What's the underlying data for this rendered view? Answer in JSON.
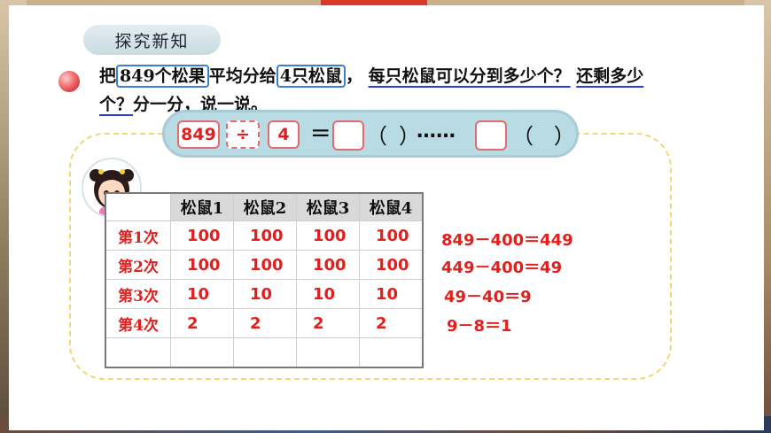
{
  "header": {
    "section_title": "探究新知"
  },
  "problem": {
    "part1": "把",
    "quantity": "849个松果",
    "part2": "平均分给",
    "squirrels": "4只松鼠",
    "part3": "，",
    "question1": "每只松鼠可以分到多少个？",
    "question2_a": "还剩多少",
    "question2_b": "个？",
    "part4": "分一分，说一说。"
  },
  "equation": {
    "dividend": "849",
    "operator": "÷",
    "divisor": "4",
    "equals": "=",
    "quotient": "",
    "unit_open": "（",
    "unit_close": "）",
    "dots": "……",
    "remainder": "",
    "unit2": "（   ）"
  },
  "table": {
    "headers": [
      "",
      "松鼠1",
      "松鼠2",
      "松鼠3",
      "松鼠4"
    ],
    "rows": [
      {
        "label": "第1次",
        "values": [
          "100",
          "100",
          "100",
          "100"
        ]
      },
      {
        "label": "第2次",
        "values": [
          "100",
          "100",
          "100",
          "100"
        ]
      },
      {
        "label": "第3次",
        "values": [
          "10",
          "10",
          "10",
          "10"
        ]
      },
      {
        "label": "第4次",
        "values": [
          "2",
          "2",
          "2",
          "2"
        ]
      },
      {
        "label": "",
        "values": [
          "",
          "",
          "",
          ""
        ]
      }
    ]
  },
  "calculations": [
    "849－400＝449",
    "449－400＝49",
    "49－40＝9",
    "9－8＝1"
  ],
  "colors": {
    "accent_red": "#e0201e",
    "box_blue": "#3a7fd0",
    "bar_blue": "#b8dbe4"
  }
}
